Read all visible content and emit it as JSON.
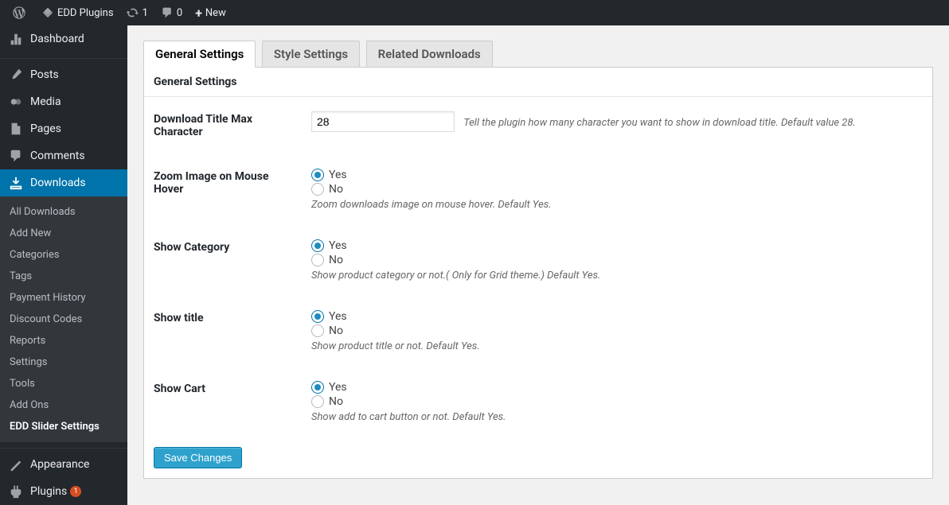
{
  "adminbar": {
    "site_title": "EDD Plugins",
    "updates_count": "1",
    "comments_count": "0",
    "new_label": "New"
  },
  "sidebar": {
    "dashboard": "Dashboard",
    "posts": "Posts",
    "media": "Media",
    "pages": "Pages",
    "comments": "Comments",
    "downloads": "Downloads",
    "downloads_sub": {
      "all": "All Downloads",
      "add_new": "Add New",
      "categories": "Categories",
      "tags": "Tags",
      "payment_history": "Payment History",
      "discount_codes": "Discount Codes",
      "reports": "Reports",
      "settings": "Settings",
      "tools": "Tools",
      "add_ons": "Add Ons",
      "edd_slider": "EDD Slider Settings"
    },
    "appearance": "Appearance",
    "plugins": "Plugins",
    "plugins_updates": "1"
  },
  "tabs": {
    "general": "General Settings",
    "style": "Style Settings",
    "related": "Related Downloads"
  },
  "panel_heading": "General Settings",
  "fields": {
    "title_max": {
      "label": "Download Title Max Character",
      "value": "28",
      "desc": "Tell the plugin how many character you want to show in download title. Default value 28."
    },
    "zoom": {
      "label": "Zoom Image on Mouse Hover",
      "yes": "Yes",
      "no": "No",
      "desc": "Zoom downloads image on mouse hover. Default Yes."
    },
    "show_category": {
      "label": "Show Category",
      "yes": "Yes",
      "no": "No",
      "desc": "Show product category or not.( Only for Grid theme.) Default Yes."
    },
    "show_title": {
      "label": "Show title",
      "yes": "Yes",
      "no": "No",
      "desc": "Show product title or not. Default Yes."
    },
    "show_cart": {
      "label": "Show Cart",
      "yes": "Yes",
      "no": "No",
      "desc": "Show add to cart button or not. Default Yes."
    }
  },
  "save_button": "Save Changes"
}
